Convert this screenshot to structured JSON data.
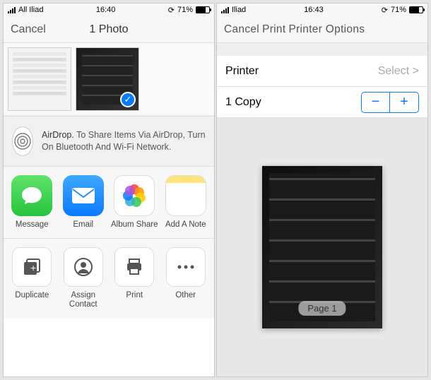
{
  "left": {
    "status": {
      "carrier": "All Iliad",
      "time": "16:40",
      "battery_pct": "71%"
    },
    "nav": {
      "cancel": "Cancel",
      "title": "1 Photo"
    },
    "airdrop": {
      "title": "AirDrop.",
      "line": "To Share Items Via AirDrop, Turn On Bluetooth And Wi-Fi Network."
    },
    "share": [
      {
        "name": "message",
        "label": "Message"
      },
      {
        "name": "email",
        "label": "Email"
      },
      {
        "name": "album-share",
        "label": "Album Share"
      },
      {
        "name": "add-note",
        "label": "Add A Note"
      }
    ],
    "actions": [
      {
        "name": "duplicate",
        "label": "Duplicate"
      },
      {
        "name": "assign-contact",
        "label": "Assign Contact"
      },
      {
        "name": "print",
        "label": "Print"
      },
      {
        "name": "other",
        "label": "Other"
      }
    ]
  },
  "right": {
    "status": {
      "carrier": "Iliad",
      "time": "16:43",
      "battery_pct": "71%"
    },
    "nav": {
      "cancel": "Cancel",
      "print": "Print",
      "title": "Printer Options"
    },
    "printer_row": {
      "label": "Printer",
      "value": "Select >"
    },
    "copies_row": {
      "label": "1 Copy"
    },
    "stepper": {
      "minus": "−",
      "plus": "+"
    },
    "page_badge": "Page 1"
  }
}
